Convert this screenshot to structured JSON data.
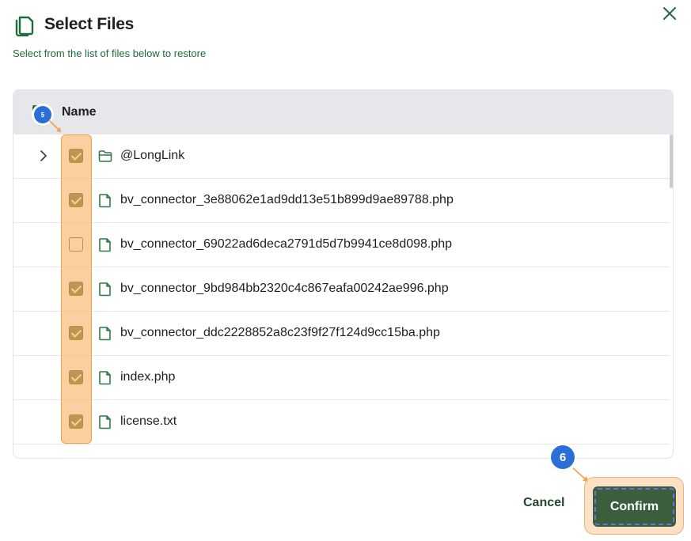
{
  "dialog": {
    "title": "Select Files",
    "subtitle": "Select from the list of files below to restore"
  },
  "table": {
    "header_label": "Name",
    "header_checked": true,
    "rows": [
      {
        "name": "@LongLink",
        "type": "folder",
        "checked": true,
        "expandable": true
      },
      {
        "name": "bv_connector_3e88062e1ad9dd13e51b899d9ae89788.php",
        "type": "file",
        "checked": true
      },
      {
        "name": "bv_connector_69022ad6deca2791d5d7b9941ce8d098.php",
        "type": "file",
        "checked": false
      },
      {
        "name": "bv_connector_9bd984bb2320c4c867eafa00242ae996.php",
        "type": "file",
        "checked": true
      },
      {
        "name": "bv_connector_ddc2228852a8c23f9f27f124d9cc15ba.php",
        "type": "file",
        "checked": true
      },
      {
        "name": "index.php",
        "type": "file",
        "checked": true
      },
      {
        "name": "license.txt",
        "type": "file",
        "checked": true
      }
    ]
  },
  "annotations": {
    "step_5": "5",
    "step_6": "6"
  },
  "footer": {
    "cancel_label": "Cancel",
    "confirm_label": "Confirm"
  },
  "icons": {
    "header": "copy-files-icon",
    "close": "close-icon",
    "folder": "folder-icon",
    "file": "file-icon",
    "expand": "chevron-right-icon"
  },
  "colors": {
    "accent_green": "#3b5f3c",
    "subtitle_green": "#1a6b3c",
    "checkbox_checked": "#5d6b2a",
    "highlight_orange": "#f2a04a",
    "marker_blue": "#2b6fd6"
  }
}
